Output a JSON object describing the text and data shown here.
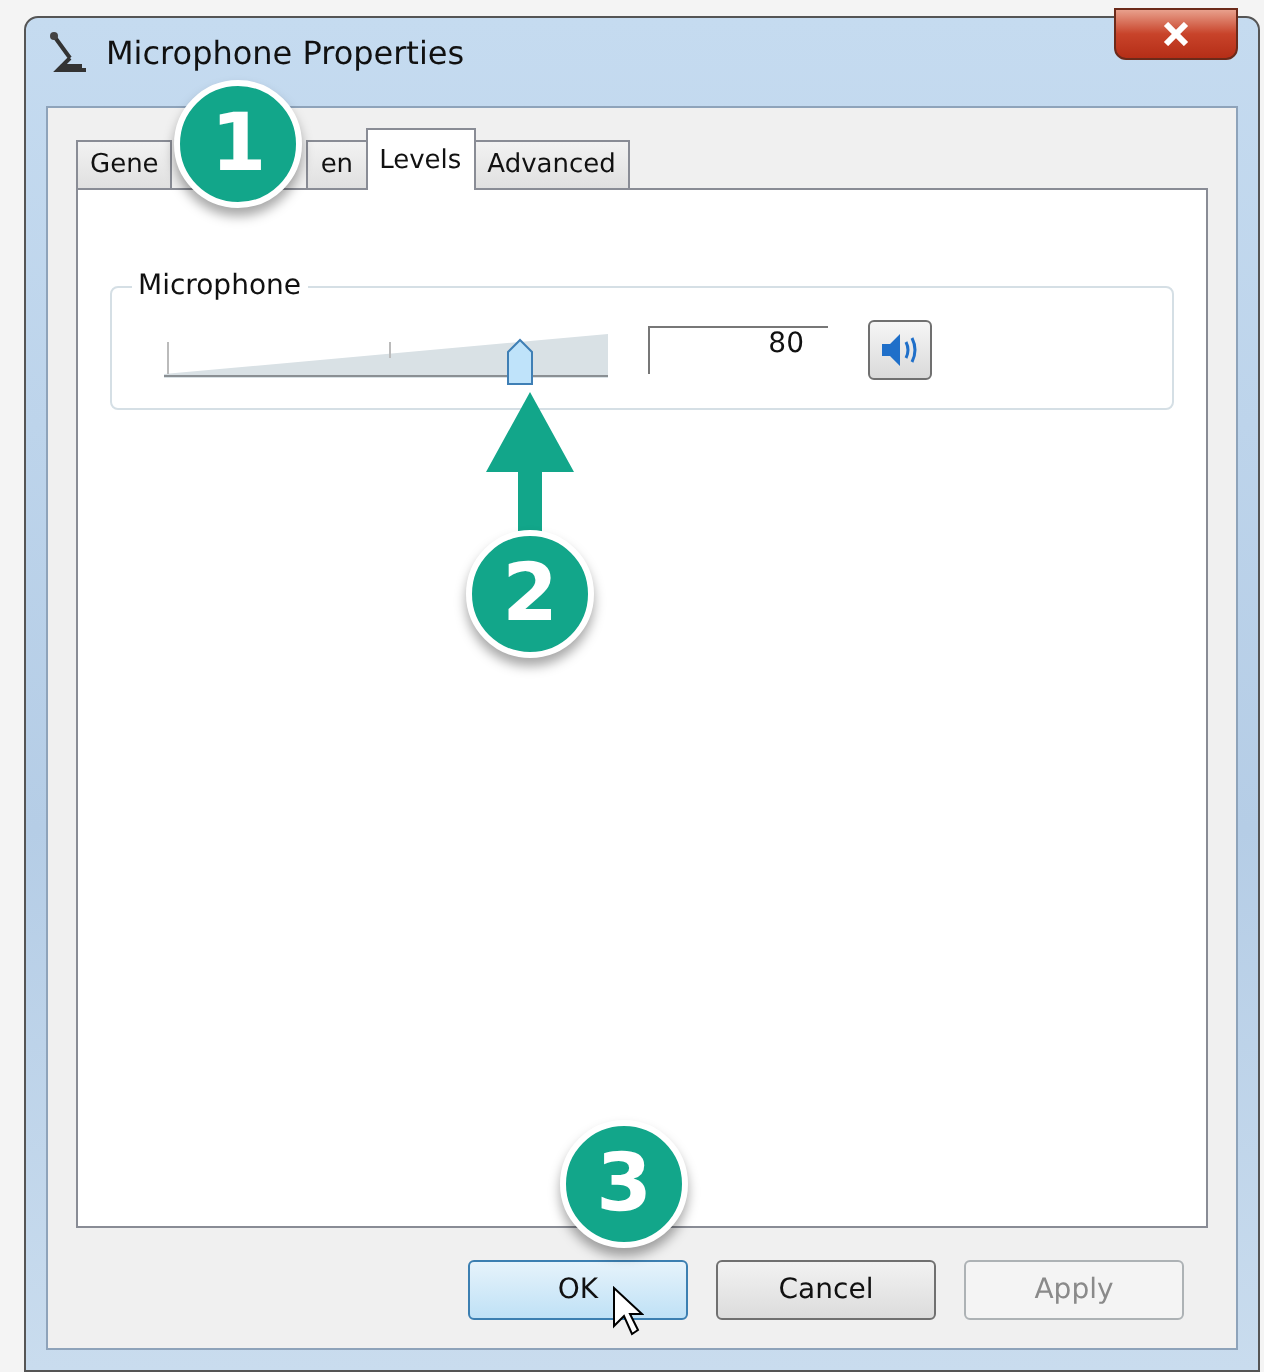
{
  "window": {
    "title": "Microphone Properties"
  },
  "tabs": [
    {
      "label": "Gene",
      "selected": false
    },
    {
      "label": "en",
      "selected": false
    },
    {
      "label": "Levels",
      "selected": true
    },
    {
      "label": "Advanced",
      "selected": false
    }
  ],
  "levels": {
    "group_label": "Microphone",
    "level": 0.8,
    "value": "80",
    "muted": false
  },
  "buttons": [
    {
      "label": "OK",
      "disabled": false
    },
    {
      "label": "Cancel",
      "disabled": false
    },
    {
      "label": "Apply",
      "disabled": true
    }
  ],
  "callouts": [
    "1",
    "2",
    "3"
  ]
}
